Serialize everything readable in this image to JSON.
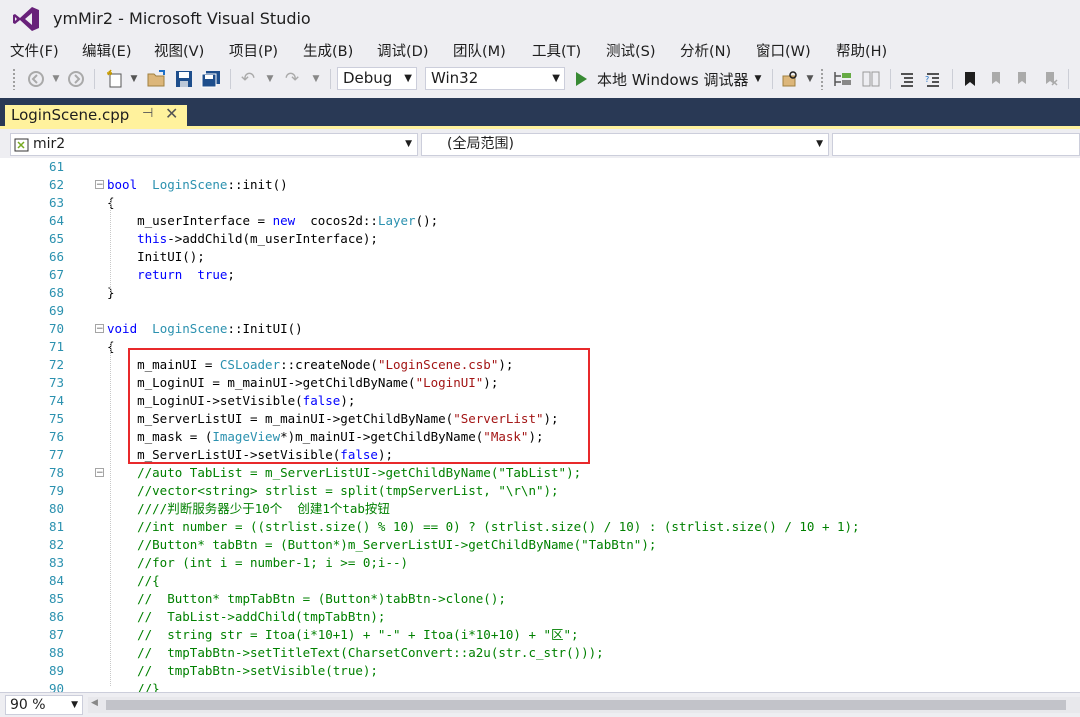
{
  "window": {
    "title": "ymMir2 - Microsoft Visual Studio"
  },
  "menu": [
    {
      "label": "文件(F)"
    },
    {
      "label": "编辑(E)"
    },
    {
      "label": "视图(V)"
    },
    {
      "label": "项目(P)"
    },
    {
      "label": "生成(B)"
    },
    {
      "label": "调试(D)"
    },
    {
      "label": "团队(M)"
    },
    {
      "label": "工具(T)"
    },
    {
      "label": "测试(S)"
    },
    {
      "label": "分析(N)"
    },
    {
      "label": "窗口(W)"
    },
    {
      "label": "帮助(H)"
    }
  ],
  "toolbar": {
    "config": "Debug",
    "platform": "Win32",
    "run_label": "本地 Windows 调试器"
  },
  "tab": {
    "label": "LoginScene.cpp"
  },
  "nav": {
    "project": "mir2",
    "scope": "(全局范围)"
  },
  "editor": {
    "lines": [
      {
        "n": "61",
        "segs": []
      },
      {
        "n": "62",
        "segs": [
          [
            "kw",
            "bool"
          ],
          [
            "",
            "  "
          ],
          [
            "ty",
            "LoginScene"
          ],
          [
            "",
            "::init()"
          ]
        ]
      },
      {
        "n": "63",
        "segs": [
          [
            "",
            "{"
          ]
        ]
      },
      {
        "n": "64",
        "segs": [
          [
            "",
            "    m_userInterface = "
          ],
          [
            "kw",
            "new"
          ],
          [
            "",
            ""
          ],
          [
            "",
            "  cocos2d::"
          ],
          [
            "ty",
            "Layer"
          ],
          [
            "",
            "();"
          ]
        ]
      },
      {
        "n": "65",
        "segs": [
          [
            "",
            "    "
          ],
          [
            "kw",
            "this"
          ],
          [
            "",
            "->addChild(m_userInterface);"
          ]
        ]
      },
      {
        "n": "66",
        "segs": [
          [
            "",
            "    InitUI();"
          ]
        ]
      },
      {
        "n": "67",
        "segs": [
          [
            "",
            "    "
          ],
          [
            "kw",
            "return"
          ],
          [
            "",
            ""
          ],
          [
            "kw",
            "  true"
          ],
          [
            "",
            ";"
          ]
        ]
      },
      {
        "n": "68",
        "segs": [
          [
            "",
            "}"
          ]
        ]
      },
      {
        "n": "69",
        "segs": []
      },
      {
        "n": "70",
        "segs": [
          [
            "kw",
            "void"
          ],
          [
            "",
            "  "
          ],
          [
            "ty",
            "LoginScene"
          ],
          [
            "",
            "::InitUI()"
          ]
        ]
      },
      {
        "n": "71",
        "segs": [
          [
            "",
            "{"
          ]
        ]
      },
      {
        "n": "72",
        "segs": [
          [
            "",
            "    m_mainUI = "
          ],
          [
            "ty",
            "CSLoader"
          ],
          [
            "",
            "::createNode("
          ],
          [
            "st",
            "\"LoginScene.csb\""
          ],
          [
            "",
            ");"
          ]
        ]
      },
      {
        "n": "73",
        "segs": [
          [
            "",
            "    m_LoginUI = m_mainUI->getChildByName("
          ],
          [
            "st",
            "\"LoginUI\""
          ],
          [
            "",
            ");"
          ]
        ]
      },
      {
        "n": "74",
        "segs": [
          [
            "",
            "    m_LoginUI->setVisible("
          ],
          [
            "kw",
            "false"
          ],
          [
            "",
            ");"
          ]
        ]
      },
      {
        "n": "75",
        "segs": [
          [
            "",
            "    m_ServerListUI = m_mainUI->getChildByName("
          ],
          [
            "st",
            "\"ServerList\""
          ],
          [
            "",
            ");"
          ]
        ]
      },
      {
        "n": "76",
        "segs": [
          [
            "",
            "    m_mask = ("
          ],
          [
            "ty",
            "ImageView"
          ],
          [
            "",
            "*)m_mainUI->getChildByName("
          ],
          [
            "st",
            "\"Mask\""
          ],
          [
            "",
            ");"
          ]
        ]
      },
      {
        "n": "77",
        "segs": [
          [
            "",
            "    m_ServerListUI->setVisible("
          ],
          [
            "kw",
            "false"
          ],
          [
            "",
            ");"
          ]
        ]
      },
      {
        "n": "78",
        "segs": [
          [
            "",
            "    "
          ],
          [
            "cm",
            "//auto TabList = m_ServerListUI->getChildByName(\"TabList\");"
          ]
        ]
      },
      {
        "n": "79",
        "segs": [
          [
            "",
            "    "
          ],
          [
            "cm",
            "//vector<string> strlist = split(tmpServerList, \"\\r\\n\");"
          ]
        ]
      },
      {
        "n": "80",
        "segs": [
          [
            "",
            "    "
          ],
          [
            "cm",
            "////判断服务器少于10个  创建1个tab按钮"
          ]
        ]
      },
      {
        "n": "81",
        "segs": [
          [
            "",
            "    "
          ],
          [
            "cm",
            "//int number = ((strlist.size() % 10) == 0) ? (strlist.size() / 10) : (strlist.size() / 10 + 1);"
          ]
        ]
      },
      {
        "n": "82",
        "segs": [
          [
            "",
            "    "
          ],
          [
            "cm",
            "//Button* tabBtn = (Button*)m_ServerListUI->getChildByName(\"TabBtn\");"
          ]
        ]
      },
      {
        "n": "83",
        "segs": [
          [
            "",
            "    "
          ],
          [
            "cm",
            "//for (int i = number-1; i >= 0;i--)"
          ]
        ]
      },
      {
        "n": "84",
        "segs": [
          [
            "",
            "    "
          ],
          [
            "cm",
            "//{"
          ]
        ]
      },
      {
        "n": "85",
        "segs": [
          [
            "",
            "    "
          ],
          [
            "cm",
            "//  Button* tmpTabBtn = (Button*)tabBtn->clone();"
          ]
        ]
      },
      {
        "n": "86",
        "segs": [
          [
            "",
            "    "
          ],
          [
            "cm",
            "//  TabList->addChild(tmpTabBtn);"
          ]
        ]
      },
      {
        "n": "87",
        "segs": [
          [
            "",
            "    "
          ],
          [
            "cm",
            "//  string str = Itoa(i*10+1) + \"-\" + Itoa(i*10+10) + \"区\";"
          ]
        ]
      },
      {
        "n": "88",
        "segs": [
          [
            "",
            "    "
          ],
          [
            "cm",
            "//  tmpTabBtn->setTitleText(CharsetConvert::a2u(str.c_str()));"
          ]
        ]
      },
      {
        "n": "89",
        "segs": [
          [
            "",
            "    "
          ],
          [
            "cm",
            "//  tmpTabBtn->setVisible(true);"
          ]
        ]
      },
      {
        "n": "90",
        "segs": [
          [
            "",
            "    "
          ],
          [
            "cm",
            "//}"
          ]
        ]
      }
    ]
  },
  "status": {
    "zoom": "90 %"
  },
  "colors": {
    "tab_active": "#fff29d",
    "tabstrip": "#293955",
    "highlight": "#e8292b"
  }
}
